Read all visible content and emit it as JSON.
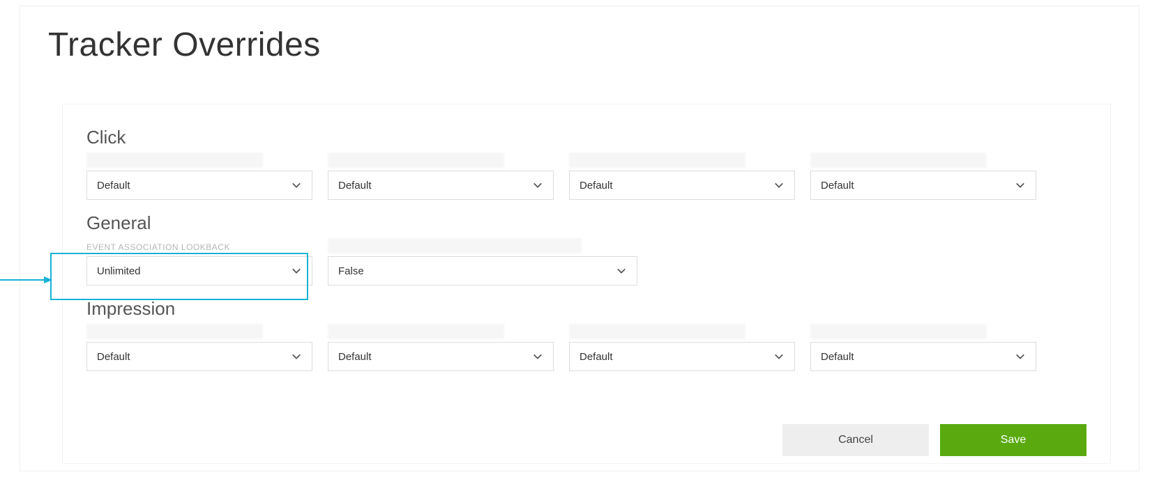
{
  "title": "Tracker Overrides",
  "sections": {
    "click": {
      "heading": "Click",
      "fields": [
        {
          "value": "Default"
        },
        {
          "value": "Default"
        },
        {
          "value": "Default"
        },
        {
          "value": "Default"
        }
      ]
    },
    "general": {
      "heading": "General",
      "fields": [
        {
          "label": "EVENT ASSOCIATION LOOKBACK",
          "value": "Unlimited"
        },
        {
          "value": "False"
        }
      ]
    },
    "impression": {
      "heading": "Impression",
      "fields": [
        {
          "value": "Default"
        },
        {
          "value": "Default"
        },
        {
          "value": "Default"
        },
        {
          "value": "Default"
        }
      ]
    }
  },
  "buttons": {
    "cancel": "Cancel",
    "save": "Save"
  },
  "colors": {
    "highlight": "#17b1d6",
    "primary": "#5aaa0f"
  }
}
